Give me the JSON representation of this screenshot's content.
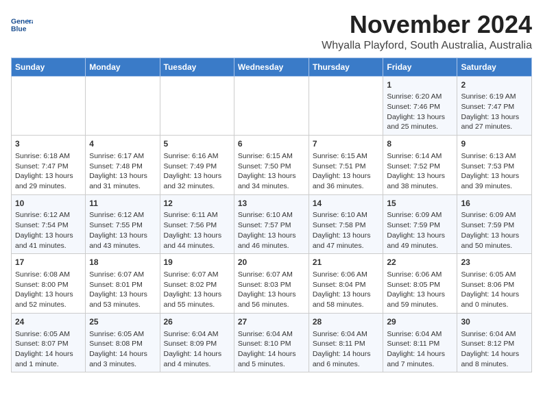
{
  "header": {
    "logo_line1": "General",
    "logo_line2": "Blue",
    "month": "November 2024",
    "location": "Whyalla Playford, South Australia, Australia"
  },
  "weekdays": [
    "Sunday",
    "Monday",
    "Tuesday",
    "Wednesday",
    "Thursday",
    "Friday",
    "Saturday"
  ],
  "weeks": [
    [
      {
        "day": "",
        "info": ""
      },
      {
        "day": "",
        "info": ""
      },
      {
        "day": "",
        "info": ""
      },
      {
        "day": "",
        "info": ""
      },
      {
        "day": "",
        "info": ""
      },
      {
        "day": "1",
        "info": "Sunrise: 6:20 AM\nSunset: 7:46 PM\nDaylight: 13 hours\nand 25 minutes."
      },
      {
        "day": "2",
        "info": "Sunrise: 6:19 AM\nSunset: 7:47 PM\nDaylight: 13 hours\nand 27 minutes."
      }
    ],
    [
      {
        "day": "3",
        "info": "Sunrise: 6:18 AM\nSunset: 7:47 PM\nDaylight: 13 hours\nand 29 minutes."
      },
      {
        "day": "4",
        "info": "Sunrise: 6:17 AM\nSunset: 7:48 PM\nDaylight: 13 hours\nand 31 minutes."
      },
      {
        "day": "5",
        "info": "Sunrise: 6:16 AM\nSunset: 7:49 PM\nDaylight: 13 hours\nand 32 minutes."
      },
      {
        "day": "6",
        "info": "Sunrise: 6:15 AM\nSunset: 7:50 PM\nDaylight: 13 hours\nand 34 minutes."
      },
      {
        "day": "7",
        "info": "Sunrise: 6:15 AM\nSunset: 7:51 PM\nDaylight: 13 hours\nand 36 minutes."
      },
      {
        "day": "8",
        "info": "Sunrise: 6:14 AM\nSunset: 7:52 PM\nDaylight: 13 hours\nand 38 minutes."
      },
      {
        "day": "9",
        "info": "Sunrise: 6:13 AM\nSunset: 7:53 PM\nDaylight: 13 hours\nand 39 minutes."
      }
    ],
    [
      {
        "day": "10",
        "info": "Sunrise: 6:12 AM\nSunset: 7:54 PM\nDaylight: 13 hours\nand 41 minutes."
      },
      {
        "day": "11",
        "info": "Sunrise: 6:12 AM\nSunset: 7:55 PM\nDaylight: 13 hours\nand 43 minutes."
      },
      {
        "day": "12",
        "info": "Sunrise: 6:11 AM\nSunset: 7:56 PM\nDaylight: 13 hours\nand 44 minutes."
      },
      {
        "day": "13",
        "info": "Sunrise: 6:10 AM\nSunset: 7:57 PM\nDaylight: 13 hours\nand 46 minutes."
      },
      {
        "day": "14",
        "info": "Sunrise: 6:10 AM\nSunset: 7:58 PM\nDaylight: 13 hours\nand 47 minutes."
      },
      {
        "day": "15",
        "info": "Sunrise: 6:09 AM\nSunset: 7:59 PM\nDaylight: 13 hours\nand 49 minutes."
      },
      {
        "day": "16",
        "info": "Sunrise: 6:09 AM\nSunset: 7:59 PM\nDaylight: 13 hours\nand 50 minutes."
      }
    ],
    [
      {
        "day": "17",
        "info": "Sunrise: 6:08 AM\nSunset: 8:00 PM\nDaylight: 13 hours\nand 52 minutes."
      },
      {
        "day": "18",
        "info": "Sunrise: 6:07 AM\nSunset: 8:01 PM\nDaylight: 13 hours\nand 53 minutes."
      },
      {
        "day": "19",
        "info": "Sunrise: 6:07 AM\nSunset: 8:02 PM\nDaylight: 13 hours\nand 55 minutes."
      },
      {
        "day": "20",
        "info": "Sunrise: 6:07 AM\nSunset: 8:03 PM\nDaylight: 13 hours\nand 56 minutes."
      },
      {
        "day": "21",
        "info": "Sunrise: 6:06 AM\nSunset: 8:04 PM\nDaylight: 13 hours\nand 58 minutes."
      },
      {
        "day": "22",
        "info": "Sunrise: 6:06 AM\nSunset: 8:05 PM\nDaylight: 13 hours\nand 59 minutes."
      },
      {
        "day": "23",
        "info": "Sunrise: 6:05 AM\nSunset: 8:06 PM\nDaylight: 14 hours\nand 0 minutes."
      }
    ],
    [
      {
        "day": "24",
        "info": "Sunrise: 6:05 AM\nSunset: 8:07 PM\nDaylight: 14 hours\nand 1 minute."
      },
      {
        "day": "25",
        "info": "Sunrise: 6:05 AM\nSunset: 8:08 PM\nDaylight: 14 hours\nand 3 minutes."
      },
      {
        "day": "26",
        "info": "Sunrise: 6:04 AM\nSunset: 8:09 PM\nDaylight: 14 hours\nand 4 minutes."
      },
      {
        "day": "27",
        "info": "Sunrise: 6:04 AM\nSunset: 8:10 PM\nDaylight: 14 hours\nand 5 minutes."
      },
      {
        "day": "28",
        "info": "Sunrise: 6:04 AM\nSunset: 8:11 PM\nDaylight: 14 hours\nand 6 minutes."
      },
      {
        "day": "29",
        "info": "Sunrise: 6:04 AM\nSunset: 8:11 PM\nDaylight: 14 hours\nand 7 minutes."
      },
      {
        "day": "30",
        "info": "Sunrise: 6:04 AM\nSunset: 8:12 PM\nDaylight: 14 hours\nand 8 minutes."
      }
    ]
  ]
}
